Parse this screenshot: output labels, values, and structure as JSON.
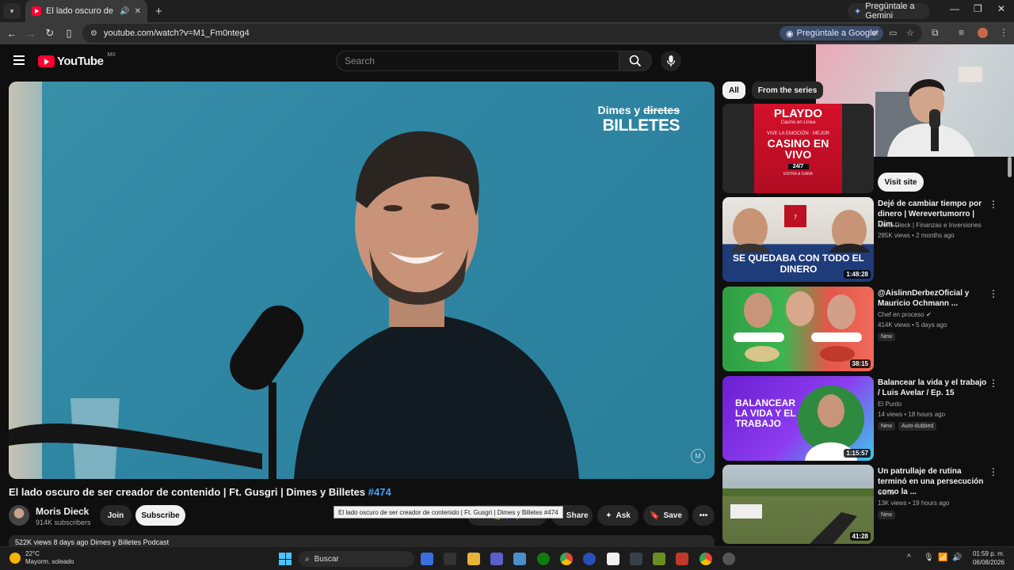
{
  "browser": {
    "tab_title": "El lado oscuro de ser creador de contenido",
    "new_tab": "+",
    "gemini_label": "Pregúntale a Gemini",
    "url": "youtube.com/watch?v=M1_Fm0nteg4",
    "google_ask": "Pregúntale a Google"
  },
  "yt": {
    "logo_text": "YouTube",
    "country": "MX",
    "search_placeholder": "Search"
  },
  "player": {
    "brand_line1_pre": "Dimes y",
    "brand_line1_strike": "diretes",
    "brand_line2": "BILLETES",
    "watermark": "M"
  },
  "video": {
    "title": "El lado oscuro de ser creador de contenido | Ft. Gusgri | Dimes y Billetes",
    "hashtag": "#474",
    "channel": "Moris Dieck",
    "subscribers": "914K subscribers",
    "join": "Join",
    "subscribe": "Subscribe",
    "tooltip": "El lado oscuro de ser creador de contenido | Ft. Gusgri | Dimes y Billetes #474",
    "share": "Share",
    "ask": "Ask",
    "save": "Save",
    "views_line": "522K views  8 days ago  Dimes y Billetes Podcast"
  },
  "sidebar": {
    "chips": [
      "All",
      "From the series"
    ],
    "ad": {
      "brand": "PLAYDO",
      "sub": "Casino en Línea",
      "line1": "VIVE LA EMOCIÓN · MEJOR",
      "big": "CASINO EN VIVO",
      "tag": "24/7",
      "cta": "ENTRA & GANA",
      "visit": "Visit site"
    },
    "recs": [
      {
        "title": "Dejé de cambiar tiempo por dinero | Werevertumorro | Dim...",
        "channel": "Moris Dieck | Finanzas e Inversiones",
        "views": "285K views • 2 months ago",
        "duration": "1:48:28",
        "thumb_text": "SE QUEDABA CON TODO EL DINERO",
        "badges": []
      },
      {
        "title": "@AislinnDerbezOficial y Mauricio Ochmann ...",
        "channel": "Chef en proceso",
        "views": "414K views • 5 days ago",
        "duration": "38:15",
        "thumb_text": "",
        "badges": [
          "New"
        ]
      },
      {
        "title": "Balancear la vida y el trabajo / Luis Avelar / Ep. 15",
        "channel": "El Punto",
        "views": "14 views • 18 hours ago",
        "duration": "1:15:57",
        "thumb_text": "BALANCEAR LA VIDA Y EL TRABAJO",
        "badges": [
          "New",
          "Auto-dubbed"
        ]
      },
      {
        "title": "Un patrullaje de rutina terminó en una persecución como la ...",
        "channel": "Sumo",
        "views": "13K views • 19 hours ago",
        "duration": "41:28",
        "thumb_text": "",
        "badges": [
          "New"
        ]
      }
    ]
  },
  "taskbar": {
    "temp": "22°C",
    "weather": "Mayorm. soleado",
    "search": "Buscar",
    "time": "01:59 p. m.",
    "date": "06/08/2026"
  },
  "colors": {
    "accent": "#3ea6ff",
    "yt_red": "#ff0033",
    "bg": "#0f0f0f"
  }
}
